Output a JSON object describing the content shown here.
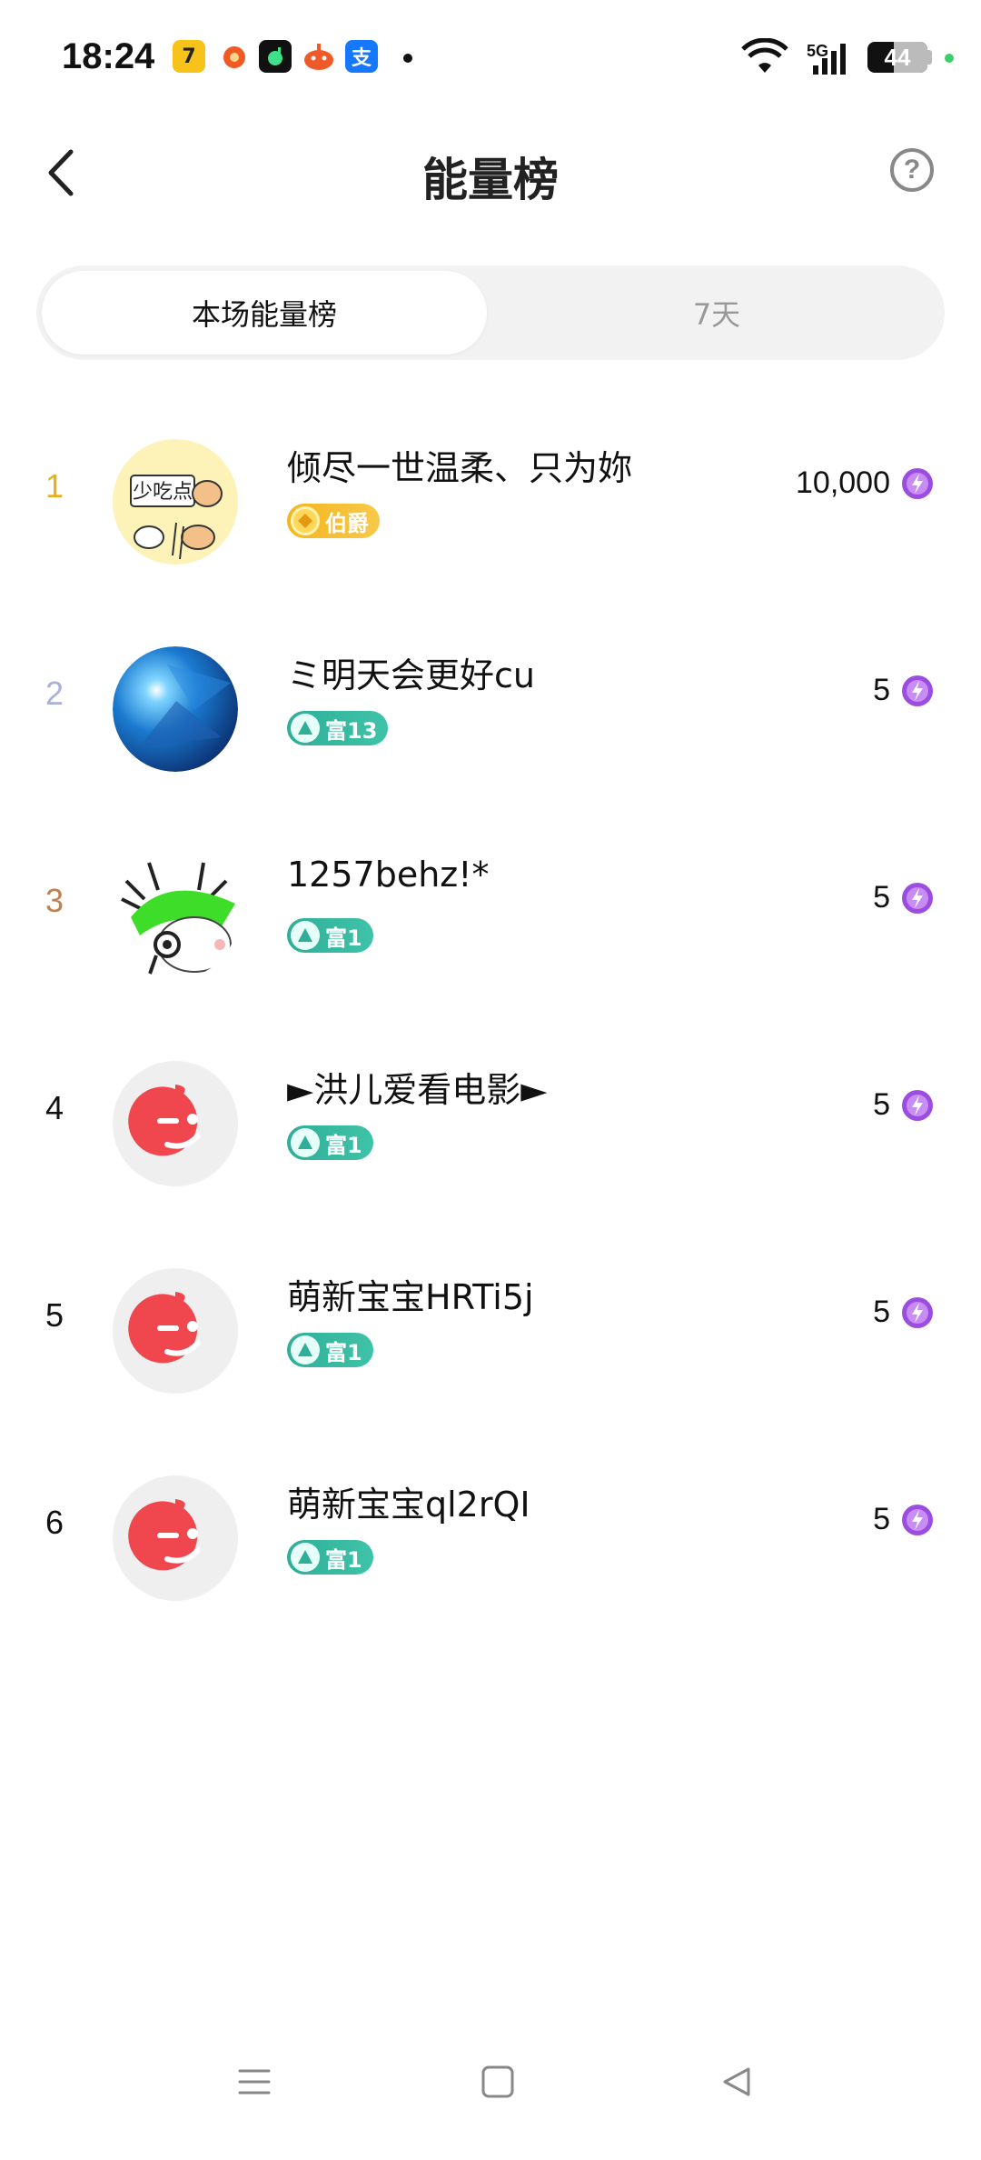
{
  "status_bar": {
    "time": "18:24",
    "network": "5G",
    "battery_level": "44",
    "battery_percent": 44,
    "app_icons": [
      "qq-music-icon",
      "weibo-icon",
      "music-icon",
      "taobao-icon",
      "alipay-icon"
    ],
    "alipay_glyph": "支"
  },
  "header": {
    "title": "能量榜",
    "help_glyph": "?"
  },
  "tabs": [
    {
      "label": "本场能量榜",
      "active": true
    },
    {
      "label": "7天",
      "active": false
    }
  ],
  "ranking": [
    {
      "rank": "1",
      "name": "倾尽一世温柔、只为妳",
      "badge": "伯爵",
      "badge_type": "gold",
      "energy": "10,000",
      "avatar_text": "少吃点",
      "rank_color": "#e8b020"
    },
    {
      "rank": "2",
      "name": "ミ明天会更好cu",
      "badge": "富13",
      "badge_type": "teal",
      "energy": "5",
      "rank_color": "#aab0d8"
    },
    {
      "rank": "3",
      "name": "1257behz!*",
      "badge": "富1",
      "badge_type": "teal",
      "energy": "5",
      "rank_color": "#c08050"
    },
    {
      "rank": "4",
      "name": "►洪儿爱看电影►",
      "badge": "富1",
      "badge_type": "teal",
      "energy": "5",
      "rank_color": "#111111"
    },
    {
      "rank": "5",
      "name": "萌新宝宝HRTi5j",
      "badge": "富1",
      "badge_type": "teal",
      "energy": "5",
      "rank_color": "#111111"
    },
    {
      "rank": "6",
      "name": "萌新宝宝ql2rQI",
      "badge": "富1",
      "badge_type": "teal",
      "energy": "5",
      "rank_color": "#111111"
    }
  ],
  "colors": {
    "gold": "#f5b51e",
    "teal": "#2fae98",
    "energy_purple": "#9b4de0",
    "default_avatar": "#f0474f"
  }
}
